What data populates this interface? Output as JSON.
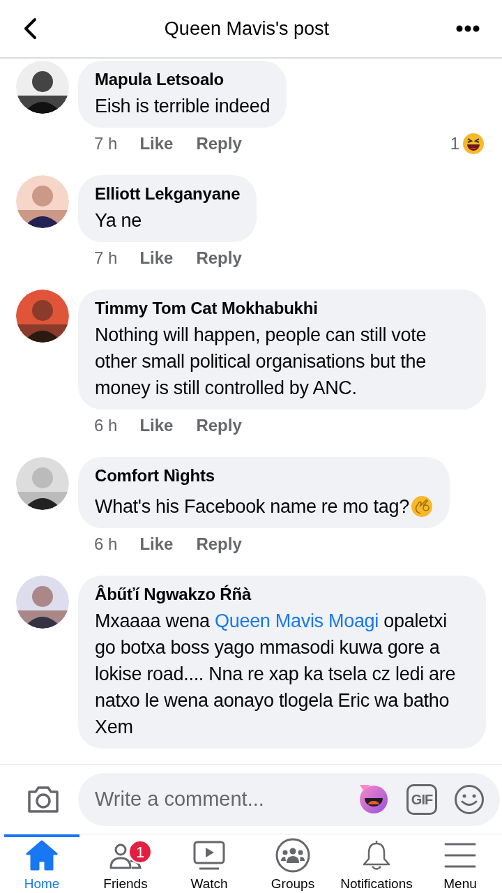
{
  "header": {
    "title": "Queen Mavis's post"
  },
  "comments": [
    {
      "author": "Mapula Letsoalo",
      "body": [
        {
          "kind": "text",
          "text": "Eish is terrible indeed"
        }
      ],
      "time": "7 h",
      "like": "Like",
      "reply": "Reply",
      "reaction_count": "1"
    },
    {
      "author": "Elliott Lekganyane",
      "body": [
        {
          "kind": "text",
          "text": "Ya ne"
        }
      ],
      "time": "7 h",
      "like": "Like",
      "reply": "Reply"
    },
    {
      "author": "Timmy Tom Cat Mokhabukhi",
      "body": [
        {
          "kind": "text",
          "text": "Nothing will happen, people can still vote other small political organisations but the money is still controlled by ANC."
        }
      ],
      "time": "6 h",
      "like": "Like",
      "reply": "Reply"
    },
    {
      "author": "Comfort Nìghts",
      "body": [
        {
          "kind": "text",
          "text": "What's his Facebook name re mo tag?"
        },
        {
          "kind": "emoji"
        }
      ],
      "time": "6 h",
      "like": "Like",
      "reply": "Reply"
    },
    {
      "author": "Âbűťí Ngwakzo Ŕñà",
      "body": [
        {
          "kind": "text",
          "text": "Mxaaaa wena "
        },
        {
          "kind": "mention",
          "text": "Queen Mavis Moagi"
        },
        {
          "kind": "text",
          "text": " opaletxi go botxa boss yago mmasodi kuwa gore a lokise road.... Nna re xap ka tsela cz ledi are natxo le wena aonayo tlogela Eric wa batho Xem"
        }
      ]
    }
  ],
  "composer": {
    "placeholder": "Write a comment...",
    "gif": "GIF"
  },
  "tabs": [
    {
      "label": "Home",
      "selected": true
    },
    {
      "label": "Friends",
      "selected": false,
      "badge": "1"
    },
    {
      "label": "Watch",
      "selected": false
    },
    {
      "label": "Groups",
      "selected": false
    },
    {
      "label": "Notifications",
      "selected": false
    },
    {
      "label": "Menu",
      "selected": false
    }
  ]
}
